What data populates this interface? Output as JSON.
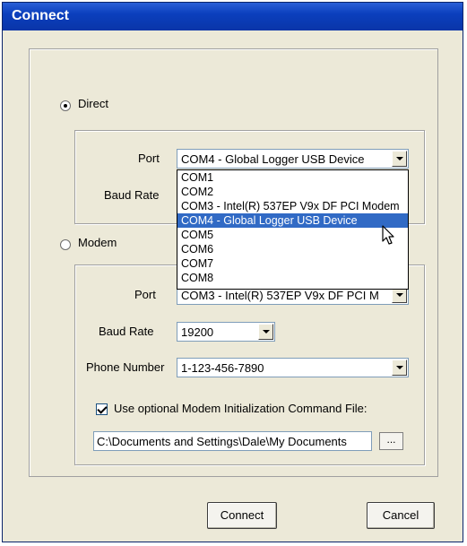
{
  "window": {
    "title": "Connect"
  },
  "direct": {
    "label": "Direct",
    "checked": true,
    "port_label": "Port",
    "port_value": "COM4 - Global Logger USB Device",
    "baud_label": "Baud Rate"
  },
  "port_dropdown": {
    "options": [
      "COM1",
      "COM2",
      "COM3 - Intel(R) 537EP V9x DF PCI Modem",
      "COM4 - Global Logger USB Device",
      "COM5",
      "COM6",
      "COM7",
      "COM8"
    ],
    "selected_index": 3
  },
  "modem": {
    "label": "Modem",
    "checked": false,
    "port_label": "Port",
    "port_value": "COM3 - Intel(R) 537EP V9x DF PCI M",
    "baud_label": "Baud Rate",
    "baud_value": "19200",
    "phone_label": "Phone Number",
    "phone_value": "1-123-456-7890",
    "init_file_label": "Use optional Modem Initialization Command File:",
    "init_file_checked": true,
    "init_file_path": "C:\\Documents and Settings\\Dale\\My Documents",
    "browse_label": "..."
  },
  "buttons": {
    "connect": "Connect",
    "cancel": "Cancel"
  },
  "colors": {
    "titlebar": "#0b3fbd",
    "dialog_bg": "#ece9d8",
    "selection": "#316ac5"
  }
}
